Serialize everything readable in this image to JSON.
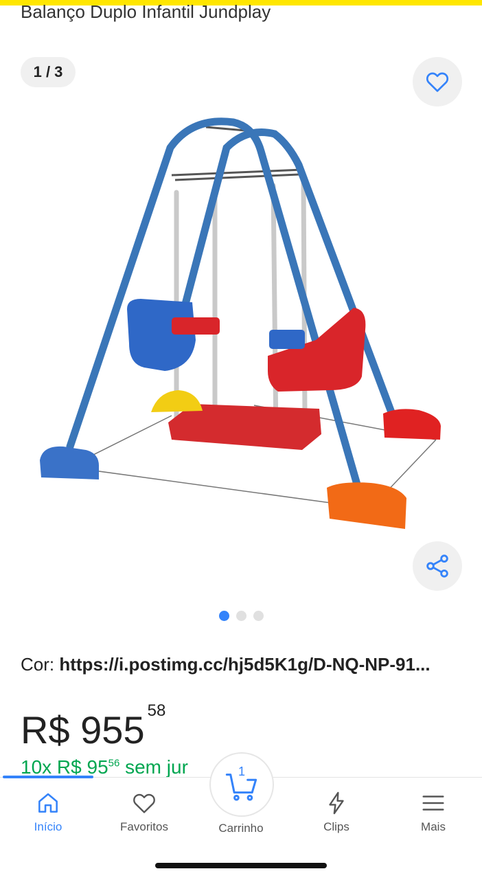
{
  "header": {
    "title": "Balanço Duplo Infantil Jundplay"
  },
  "gallery": {
    "counter": "1 / 3",
    "favorite_icon": "heart-outline-icon",
    "share_icon": "share-icon",
    "image_subject": "double swing set",
    "total_images": 3,
    "active_index": 0
  },
  "variant": {
    "label": "Cor:",
    "value": "https://i.postimg.cc/hj5d5K1g/D-NQ-NP-91..."
  },
  "price": {
    "currency": "R$",
    "amount": "955",
    "cents": "58"
  },
  "installments": {
    "prefix": "10x R$ 95",
    "cents": "56",
    "suffix": " sem jur"
  },
  "nav": {
    "items": [
      {
        "label": "Início",
        "icon": "home-icon",
        "active": true
      },
      {
        "label": "Favoritos",
        "icon": "heart-icon"
      },
      {
        "label": "Carrinho",
        "icon": "cart-icon",
        "badge": "1"
      },
      {
        "label": "Clips",
        "icon": "lightning-icon"
      },
      {
        "label": "Mais",
        "icon": "menu-icon"
      }
    ]
  },
  "colors": {
    "accent": "#3483fa",
    "brand_yellow": "#ffe600",
    "installment_green": "#00a650"
  }
}
